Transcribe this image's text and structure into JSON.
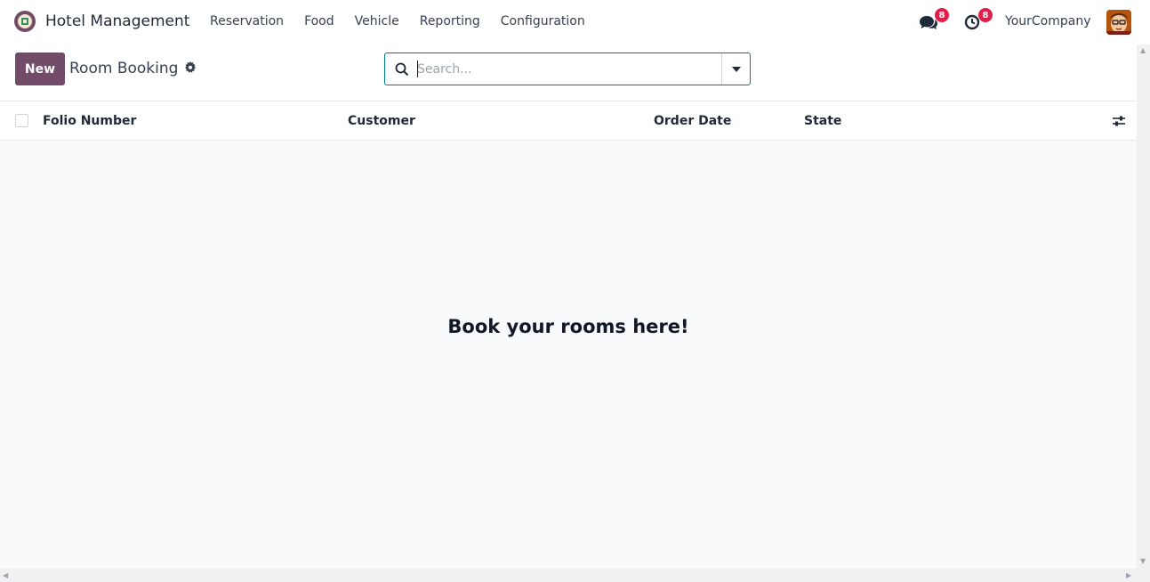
{
  "navbar": {
    "app_name": "Hotel Management",
    "menu": [
      "Reservation",
      "Food",
      "Vehicle",
      "Reporting",
      "Configuration"
    ],
    "messages_badge": "8",
    "activities_badge": "8",
    "company": "YourCompany"
  },
  "control_panel": {
    "new_label": "New",
    "breadcrumb": "Room Booking",
    "search_placeholder": "Search..."
  },
  "table": {
    "columns": [
      "Folio Number",
      "Customer",
      "Order Date",
      "State"
    ]
  },
  "empty_state": {
    "message": "Book your rooms here!"
  },
  "colors": {
    "brand": "#714b67",
    "badge": "#e11d48",
    "search_border": "#017e84"
  }
}
